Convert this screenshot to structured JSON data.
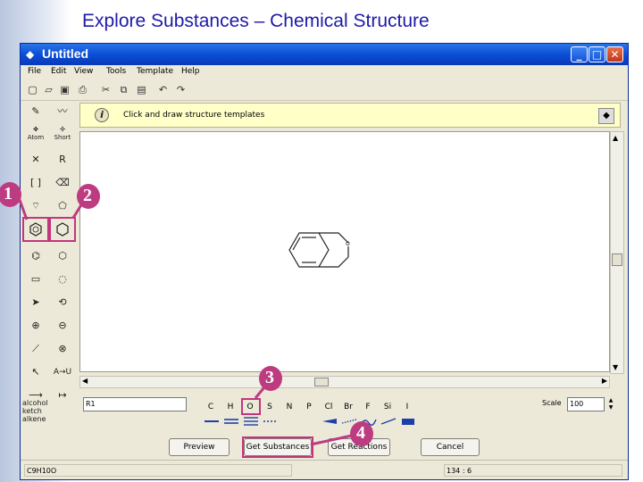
{
  "slide": {
    "title": "Explore Substances – Chemical Structure"
  },
  "window": {
    "title": "Untitled",
    "minimize_glyph": "_",
    "maximize_glyph": "□",
    "close_glyph": "✕"
  },
  "menu": [
    "File",
    "Edit",
    "View",
    "Tools",
    "Template",
    "Help"
  ],
  "palette_labels": {
    "atom": "Atom",
    "short": "Short",
    "ring": "R",
    "bracket": "[ ]",
    "arrow_transform": "A→U",
    "alcohol_lines": [
      "alcohol",
      "ketch",
      "alkene"
    ]
  },
  "info": {
    "icon_glyph": "i",
    "text": "Click and draw structure templates"
  },
  "callouts": [
    "1",
    "2",
    "3",
    "4"
  ],
  "name_field": {
    "value": "R1"
  },
  "elements": [
    "C",
    "H",
    "O",
    "S",
    "N",
    "P",
    "Cl",
    "Br",
    "F",
    "Si",
    "I"
  ],
  "scale": {
    "label": "Scale",
    "value": "100"
  },
  "buttons": {
    "preview": "Preview",
    "get_substances": "Get Substances",
    "get_reactions": "Get Reactions",
    "cancel": "Cancel"
  },
  "status": {
    "formula": "C9H10O",
    "coords": "134 : 6"
  },
  "colors": {
    "highlight": "#c2367e",
    "title_blue": "#1f1aa8",
    "titlebar": "#0b4fd6",
    "info_bg": "#ffffc8"
  },
  "icons": [
    "new-icon",
    "open-icon",
    "save-icon",
    "print-icon",
    "cut-icon",
    "copy-icon",
    "paste-icon",
    "undo-icon",
    "redo-icon"
  ]
}
